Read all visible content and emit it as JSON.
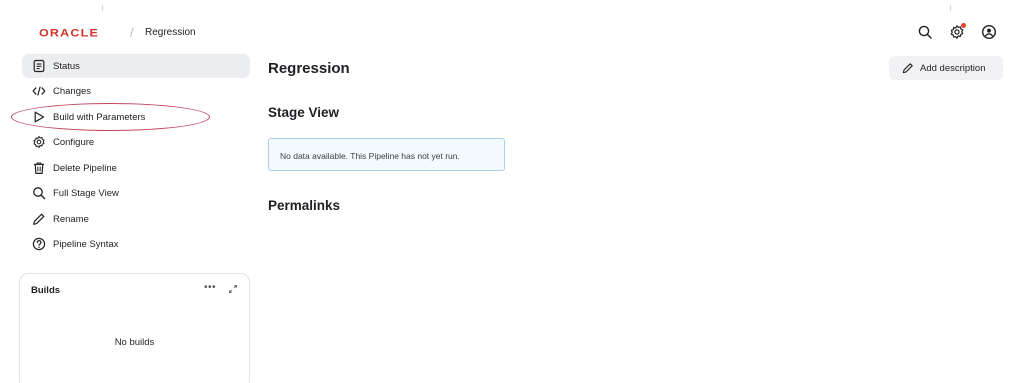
{
  "header": {
    "logo_text": "ORACLE",
    "breadcrumb_separator": "/",
    "breadcrumb": "Regression",
    "icons": [
      "search-icon",
      "gear-icon",
      "user-icon"
    ],
    "colors": {
      "logo": "#d0332b",
      "notification_dot": "#e5412c"
    }
  },
  "sidebar": {
    "items": [
      {
        "label": "Status",
        "icon": "document-icon",
        "active": true
      },
      {
        "label": "Changes",
        "icon": "code-icon"
      },
      {
        "label": "Build with Parameters",
        "icon": "play-icon"
      },
      {
        "label": "Configure",
        "icon": "gear-icon"
      },
      {
        "label": "Delete Pipeline",
        "icon": "trash-icon"
      },
      {
        "label": "Full Stage View",
        "icon": "search-icon"
      },
      {
        "label": "Rename",
        "icon": "pencil-icon"
      },
      {
        "label": "Pipeline Syntax",
        "icon": "help-icon"
      }
    ],
    "annotation_color": "#c0465e"
  },
  "builds": {
    "title": "Builds",
    "more": "•••",
    "empty_text": "No builds"
  },
  "main": {
    "title": "Regression",
    "add_description": "Add description",
    "stage_view_heading": "Stage View",
    "no_data_text": "No data available. This Pipeline has not yet run.",
    "permalinks_heading": "Permalinks",
    "colors": {
      "info_border": "#a9d1e8",
      "info_bg": "#f3f9fc"
    }
  }
}
